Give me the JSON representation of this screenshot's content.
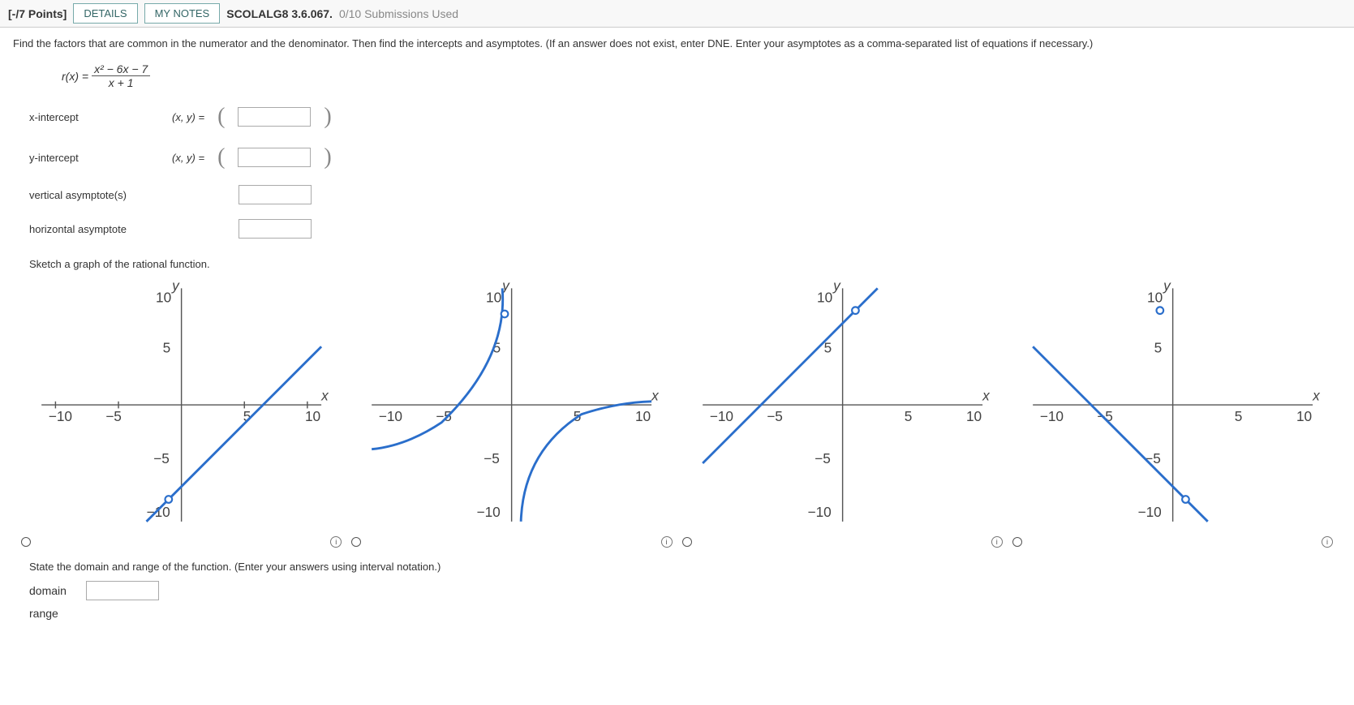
{
  "header": {
    "points": "[-/7 Points]",
    "details": "DETAILS",
    "notes": "MY NOTES",
    "qid": "SCOLALG8 3.6.067.",
    "subs": "0/10 Submissions Used"
  },
  "prompt": "Find the factors that are common in the numerator and the denominator. Then find the intercepts and asymptotes. (If an answer does not exist, enter DNE. Enter your asymptotes as a comma-separated list of equations if necessary.)",
  "formula": {
    "lhs": "r(x) =",
    "num": "x² − 6x − 7",
    "den": "x + 1"
  },
  "rows": {
    "xint": "x-intercept",
    "yint": "y-intercept",
    "va": "vertical asymptote(s)",
    "ha": "horizontal asymptote",
    "xy": "(x, y)  ="
  },
  "sketch": "Sketch a graph of the rational function.",
  "axis": {
    "x": "x",
    "y": "y",
    "nten": "−10",
    "nfive": "−5",
    "five": "5",
    "ten": "10"
  },
  "info": "i",
  "dr": {
    "label": "State the domain and range of the function. (Enter your answers using interval notation.)",
    "domain": "domain",
    "range": "range"
  }
}
